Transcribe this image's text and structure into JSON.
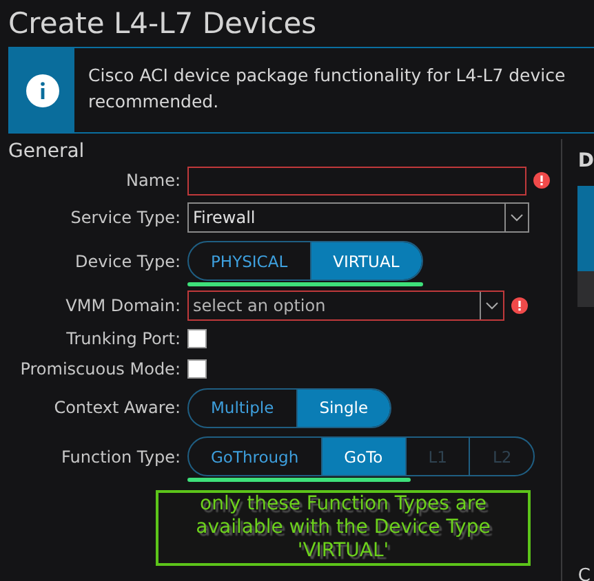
{
  "title": "Create L4-L7 Devices",
  "banner": {
    "lines": [
      "Cisco ACI device package functionality for L4-L7 device",
      "recommended."
    ]
  },
  "section": "General",
  "fields": [
    {
      "kind": "text",
      "label": "Name:",
      "required": true
    },
    {
      "kind": "select",
      "label": "Service Type:",
      "value": "Firewall",
      "required": false
    },
    {
      "kind": "segmented",
      "label": "Device Type:",
      "options": [
        {
          "label": "PHYSICAL",
          "selected": false,
          "disabled": false
        },
        {
          "label": "VIRTUAL",
          "selected": true,
          "disabled": false
        }
      ],
      "underline": true
    },
    {
      "kind": "select",
      "label": "VMM Domain:",
      "placeholder": "select an option",
      "required": true
    },
    {
      "kind": "checkbox",
      "label": "Trunking Port:",
      "checked": false
    },
    {
      "kind": "checkbox",
      "label": "Promiscuous Mode:",
      "checked": false
    },
    {
      "kind": "segmented",
      "label": "Context Aware:",
      "options": [
        {
          "label": "Multiple",
          "selected": false,
          "disabled": false
        },
        {
          "label": "Single",
          "selected": true,
          "disabled": false
        }
      ],
      "underline": false
    },
    {
      "kind": "segmented",
      "label": "Function Type:",
      "options": [
        {
          "label": "GoThrough",
          "selected": false,
          "disabled": false
        },
        {
          "label": "GoTo",
          "selected": true,
          "disabled": false
        },
        {
          "label": "L1",
          "selected": false,
          "disabled": true
        },
        {
          "label": "L2",
          "selected": false,
          "disabled": true
        }
      ],
      "underline": true
    }
  ],
  "note": "only these Function Types are available with the Device Type 'VIRTUAL'",
  "side_panel": {
    "heading": "D",
    "footer": "C"
  }
}
